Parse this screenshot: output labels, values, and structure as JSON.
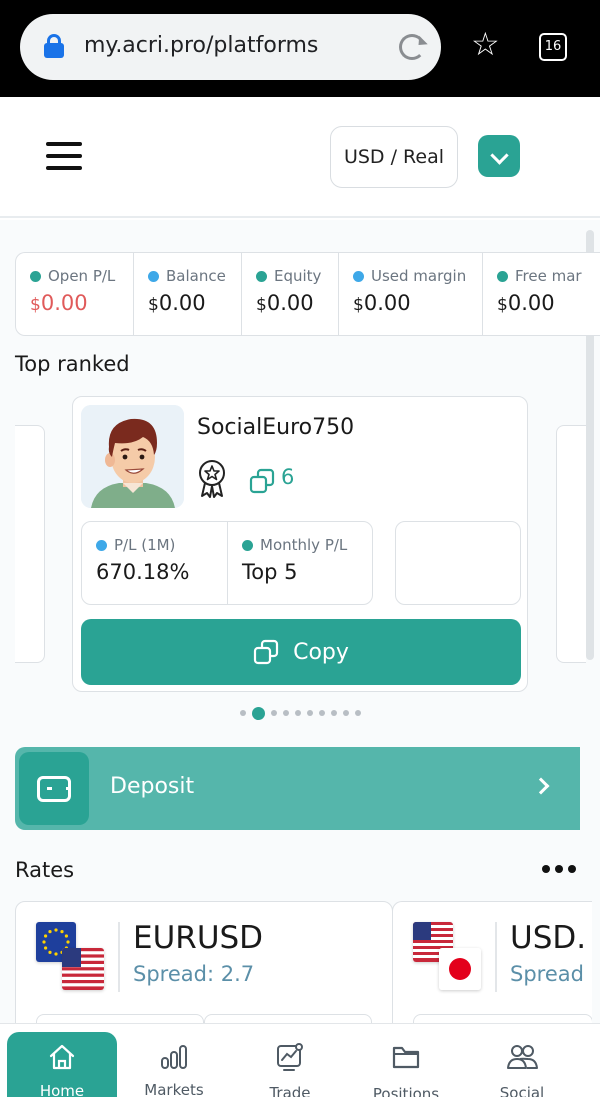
{
  "browser": {
    "url": "my.acri.pro/platforms",
    "tab_count": "16"
  },
  "header": {
    "account_selector": "USD / Real"
  },
  "account_stats": [
    {
      "label": "Open P/L",
      "currency": "$",
      "value": "0.00",
      "dot": "green",
      "value_color": "#e05a5a"
    },
    {
      "label": "Balance",
      "currency": "$",
      "value": "0.00",
      "dot": "blue"
    },
    {
      "label": "Equity",
      "currency": "$",
      "value": "0.00",
      "dot": "green"
    },
    {
      "label": "Used margin",
      "currency": "$",
      "value": "0.00",
      "dot": "blue"
    },
    {
      "label": "Free mar",
      "currency": "$",
      "value": "0.00",
      "dot": "green"
    }
  ],
  "top_ranked": {
    "title": "Top ranked",
    "trader": {
      "name": "SocialEuro750",
      "copiers": "6",
      "metrics": [
        {
          "label": "P/L (1M)",
          "value": "670.18%",
          "dot": "blue"
        },
        {
          "label": "Monthly P/L",
          "value": "Top 5",
          "dot": "green"
        }
      ],
      "copy_label": "Copy"
    },
    "carousel_active_index": 1,
    "carousel_count": 10
  },
  "deposit": {
    "label": "Deposit"
  },
  "rates": {
    "title": "Rates",
    "cards": [
      {
        "pair": "EURUSD",
        "spread": "Spread: 2.7",
        "flags": [
          "eu-flag",
          "us-flag"
        ]
      },
      {
        "pair": "USD.",
        "spread": "Spread",
        "flags": [
          "us-flag",
          "jp-flag"
        ]
      }
    ]
  },
  "bottom_nav": [
    {
      "label": "Home",
      "icon": "home-icon",
      "active": true
    },
    {
      "label": "Markets",
      "icon": "markets-icon"
    },
    {
      "label": "Trade",
      "icon": "trade-icon"
    },
    {
      "label": "Positions",
      "icon": "folder-icon"
    },
    {
      "label": "Social",
      "icon": "people-icon"
    }
  ],
  "colors": {
    "accent": "#2aa394",
    "accent_light": "#55b6ab",
    "negative": "#e05a5a",
    "info": "#3ea8e8"
  }
}
